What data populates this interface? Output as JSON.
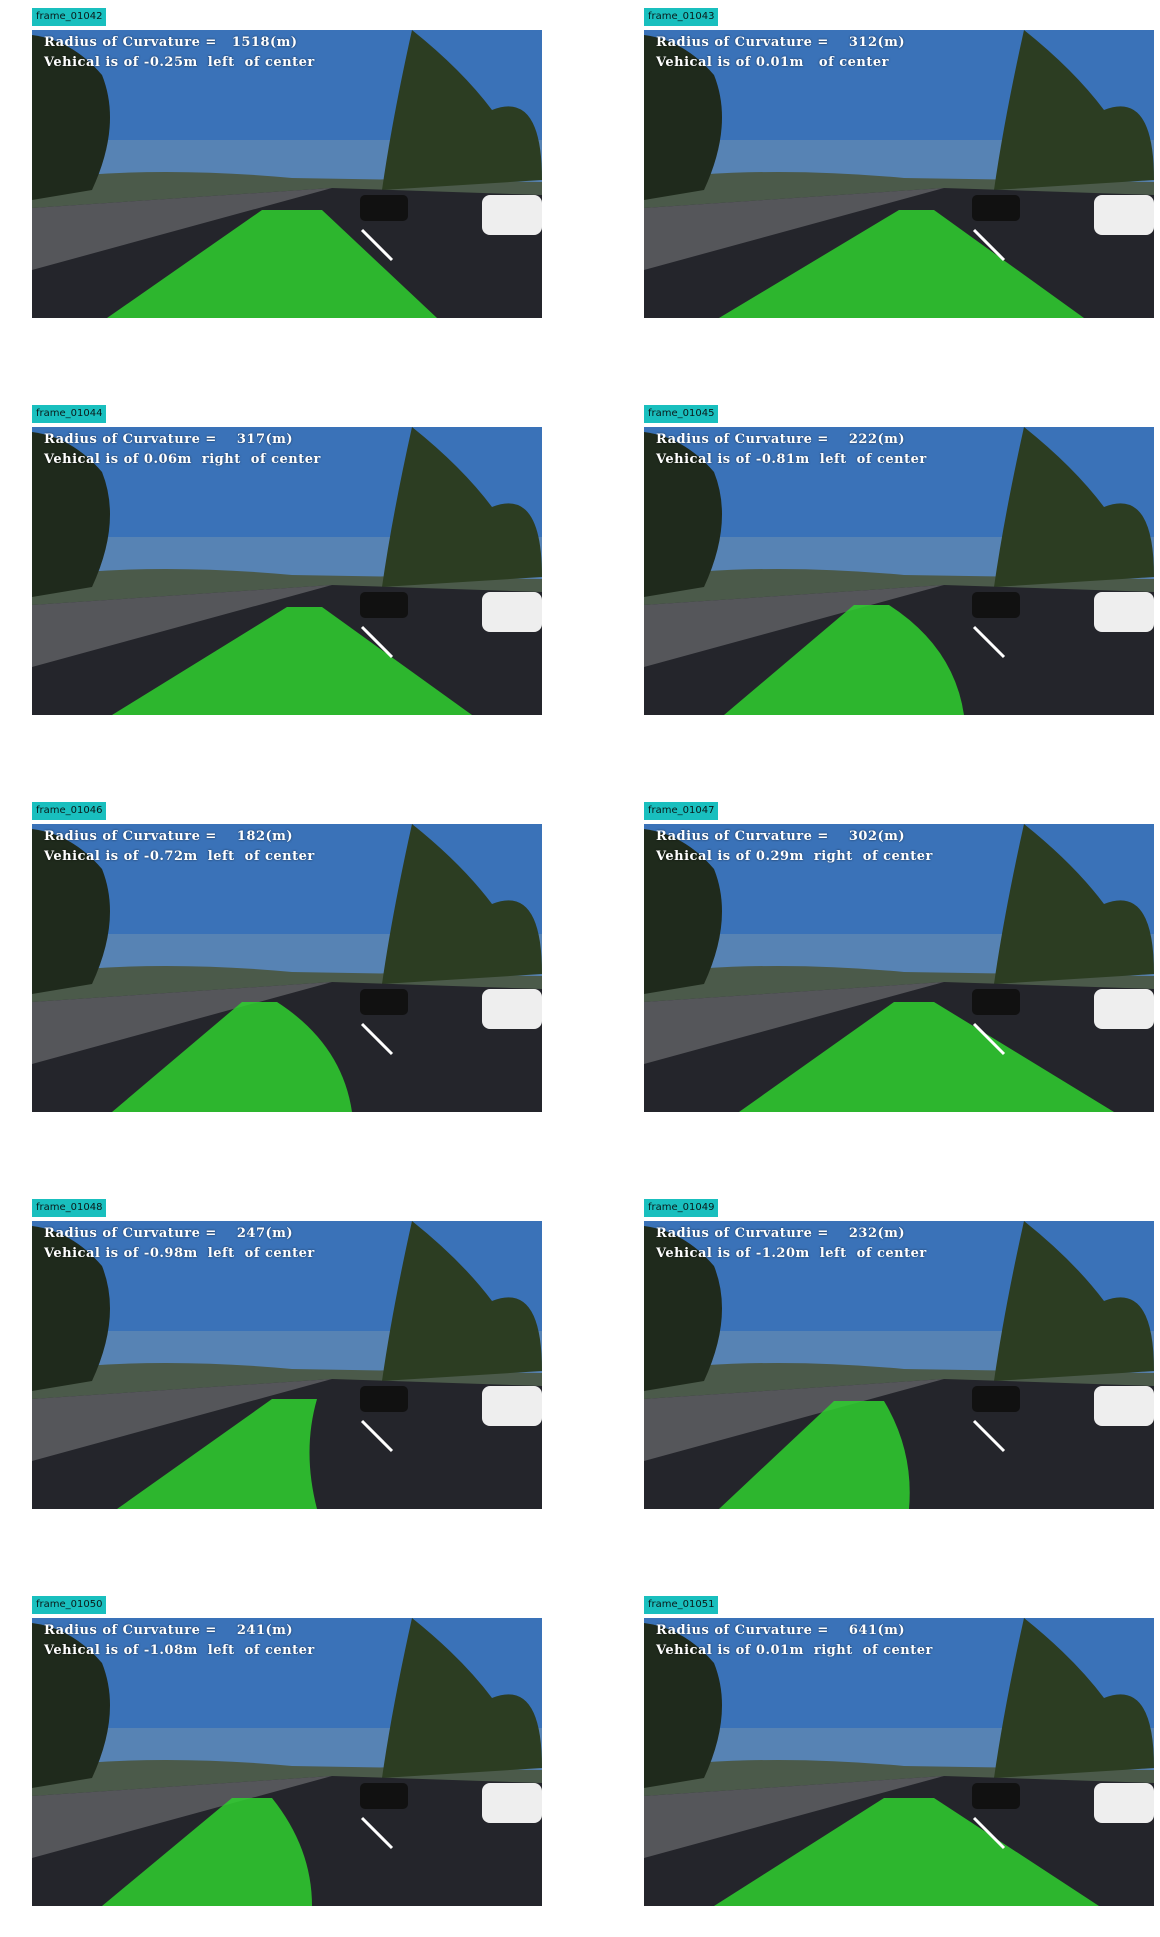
{
  "frames": [
    {
      "label": "frame_01042",
      "line1": "Radius of Curvature =   1518(m)",
      "line2": "Vehical is of -0.25m  left  of center"
    },
    {
      "label": "frame_01043",
      "line1": "Radius of Curvature =    312(m)",
      "line2": "Vehical is of 0.01m   of center"
    },
    {
      "label": "frame_01044",
      "line1": "Radius of Curvature =    317(m)",
      "line2": "Vehical is of 0.06m  right  of center"
    },
    {
      "label": "frame_01045",
      "line1": "Radius of Curvature =    222(m)",
      "line2": "Vehical is of -0.81m  left  of center"
    },
    {
      "label": "frame_01046",
      "line1": "Radius of Curvature =    182(m)",
      "line2": "Vehical is of -0.72m  left  of center"
    },
    {
      "label": "frame_01047",
      "line1": "Radius of Curvature =    302(m)",
      "line2": "Vehical is of 0.29m  right  of center"
    },
    {
      "label": "frame_01048",
      "line1": "Radius of Curvature =    247(m)",
      "line2": "Vehical is of -0.98m  left  of center"
    },
    {
      "label": "frame_01049",
      "line1": "Radius of Curvature =    232(m)",
      "line2": "Vehical is of -1.20m  left  of center"
    },
    {
      "label": "frame_01050",
      "line1": "Radius of Curvature =    241(m)",
      "line2": "Vehical is of -1.08m  left  of center"
    },
    {
      "label": "frame_01051",
      "line1": "Radius of Curvature =    641(m)",
      "line2": "Vehical is of 0.01m  right  of center"
    }
  ],
  "colors": {
    "tag_background": "#19bfbe",
    "lane_overlay": "#2fd02f",
    "sky": "#3a72b8",
    "road": "#24252b"
  }
}
